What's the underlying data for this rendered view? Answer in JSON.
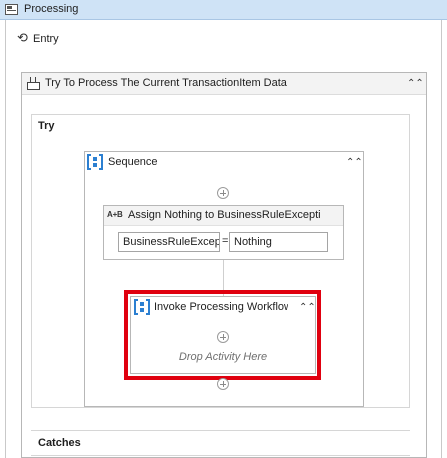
{
  "state": {
    "title": "Processing",
    "icon": "state-window-icon",
    "entry_label": "Entry",
    "entry_icon": "entry-arrow-icon"
  },
  "try_catch": {
    "title": "Try To Process The Current TransactionItem Data",
    "try_label": "Try",
    "catches_label": "Catches",
    "collapse_glyph": "⌃⌃"
  },
  "sequence": {
    "title": "Sequence",
    "collapse_glyph": "⌃⌃"
  },
  "assign": {
    "icon_text": "A+B",
    "title": "Assign Nothing to BusinessRuleExcepti",
    "left_value": "BusinessRuleExcep",
    "operator": "=",
    "right_value": "Nothing"
  },
  "invoke": {
    "title": "Invoke Processing Workflow",
    "collapse_glyph": "⌃⌃",
    "drop_text": "Drop Activity Here"
  },
  "colors": {
    "highlight": "#e0000f",
    "sequence_icon": "#2b7fd1",
    "state_header": "#cfe3f6"
  }
}
